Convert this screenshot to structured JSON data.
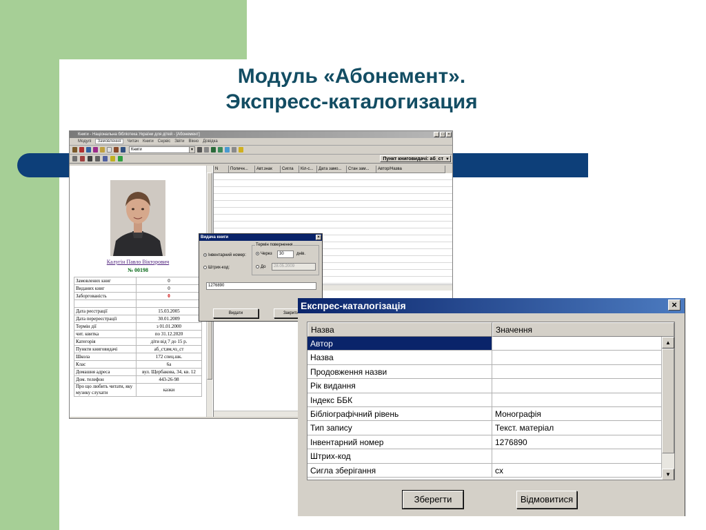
{
  "slide": {
    "title_line1": "Модуль «Абонемент».",
    "title_line2": "Экспресс-каталогизация",
    "colors": {
      "green": "#a6cf96",
      "band": "#0d3f79",
      "title": "#134d63"
    }
  },
  "main_window": {
    "title": "Книги - Національна бібліотека України для дітей - [Абонемент]",
    "menu": [
      "Модулі",
      "Замовлення",
      "Читач",
      "Книги",
      "Сервіс",
      "Звіти",
      "Вікно",
      "Довідка"
    ],
    "combo_value": "Книги",
    "punkt_label": "Пункт книговидачі: аб_ст",
    "reader": {
      "name": "Калугін Павло Вікторович",
      "number": "№ 00198",
      "fields": [
        {
          "label": "Замовлених книг",
          "value": "0"
        },
        {
          "label": "Виданих книг",
          "value": "0"
        },
        {
          "label": "Заборгованість",
          "value": "0"
        },
        {
          "label": "",
          "value": ""
        },
        {
          "label": "Дата реєстрації",
          "value": "15.03.2005"
        },
        {
          "label": "Дата перереєстрації",
          "value": "30.01.2009"
        },
        {
          "label": "Термін дії",
          "value": "з    01.01.2000"
        },
        {
          "label": "чит. квитка",
          "value": "по 31.12.2020"
        },
        {
          "label": "Категорія",
          "value": "діти від 7 до 15 р."
        },
        {
          "label": "Пункти книговидачі",
          "value": "аб_ст,вм,чз_ст"
        },
        {
          "label": "Школа",
          "value": "172 спец.шк."
        },
        {
          "label": "Клас",
          "value": "6а"
        },
        {
          "label": "Домашня адреса",
          "value": "вул. Щербакова, 34, кв. 12"
        },
        {
          "label": "Дом. телефон",
          "value": "443-26-98"
        },
        {
          "label": "Про що любить читати, яку музику слухати",
          "value": "казки"
        }
      ]
    },
    "grid_columns": [
      "N",
      "Поличн...",
      "Авт.знак",
      "Сигла",
      "Кіл-с...",
      "Дата замо...",
      "Стан зам...",
      "Автор/Назва"
    ]
  },
  "issue_dialog": {
    "title": "Видача книги",
    "radio_inventory": "Інвентарний номер:",
    "radio_barcode": "Штрих-код:",
    "term_legend": "Термін повернення",
    "after_label": "Через",
    "days_value": "30",
    "days_label": "днів.",
    "until_label": "До",
    "date_value": "28.05.2009",
    "input_value": "1276890",
    "issue_button": "Видати",
    "close_button": "Закрити"
  },
  "express_dialog": {
    "title": "Експрес-каталогізація",
    "col_name": "Назва",
    "col_value": "Значення",
    "rows": [
      {
        "name": "Автор",
        "value": ""
      },
      {
        "name": "Назва",
        "value": ""
      },
      {
        "name": "Продовження назви",
        "value": ""
      },
      {
        "name": "Рік видання",
        "value": ""
      },
      {
        "name": "Індекс ББК",
        "value": ""
      },
      {
        "name": "Бібліографічний рівень",
        "value": "Монографія"
      },
      {
        "name": "Тип запису",
        "value": "Текст. матеріал"
      },
      {
        "name": "Інвентарний номер",
        "value": "1276890"
      },
      {
        "name": "Штрих-код",
        "value": ""
      },
      {
        "name": "Сигла зберігання",
        "value": "сх"
      }
    ],
    "save_button": "Зберегти",
    "cancel_button": "Відмовитися"
  }
}
